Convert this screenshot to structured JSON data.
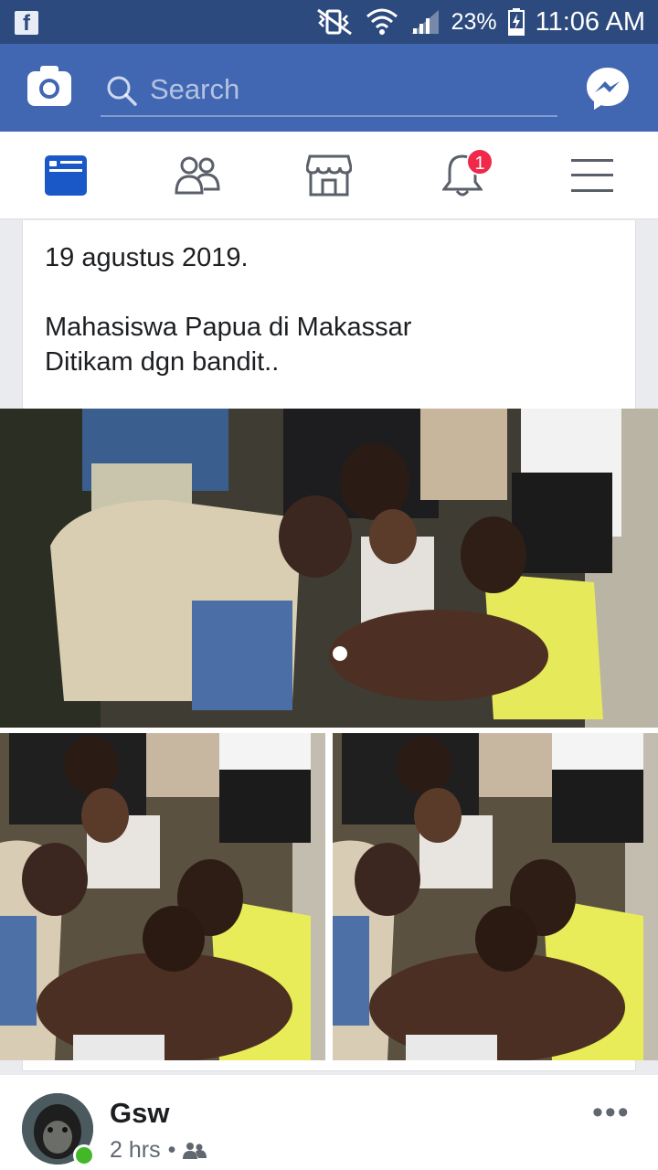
{
  "status_bar": {
    "battery_percent": "23%",
    "time": "11:06 AM"
  },
  "app_bar": {
    "search_placeholder": "Search"
  },
  "tabs": [
    {
      "name": "news-feed",
      "active": true
    },
    {
      "name": "friends"
    },
    {
      "name": "marketplace"
    },
    {
      "name": "notifications",
      "badge": "1"
    },
    {
      "name": "menu"
    }
  ],
  "post": {
    "date_line": "19 agustus 2019.",
    "body_line1": "Mahasiswa Papua di Makassar",
    "body_line2": "Ditikam dgn bandit.."
  },
  "next_post": {
    "author": "Gsw",
    "time": "2 hrs",
    "separator": "•"
  },
  "colors": {
    "status_bar": "#2d4a7e",
    "app_bar": "#4267b2",
    "badge": "#f02849",
    "online": "#42b72a"
  }
}
